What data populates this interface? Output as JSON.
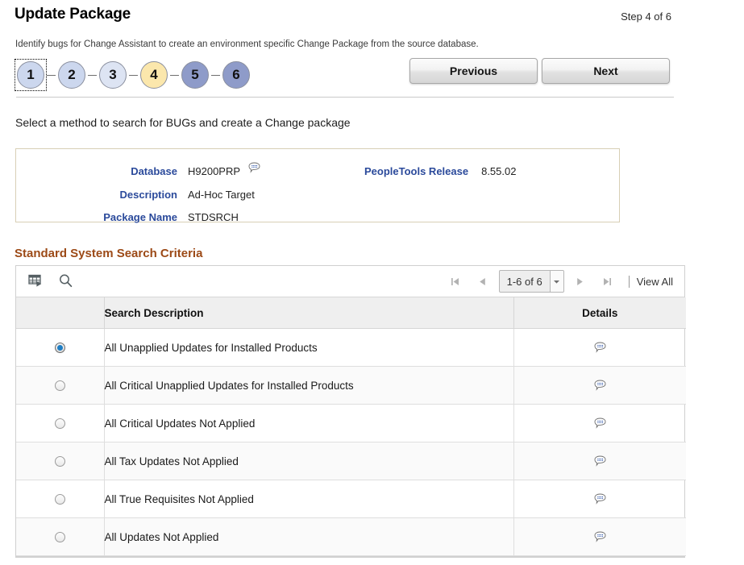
{
  "header": {
    "title": "Update Package",
    "step_of": "Step 4 of 6"
  },
  "instruction": "Identify bugs for Change Assistant to create an environment specific Change Package from the source database.",
  "sub_instruction": "Select a method to search for BUGs and create a Change package",
  "steps": [
    {
      "number": "1",
      "state": "done",
      "color": "#ccd7ee",
      "focused": true
    },
    {
      "number": "2",
      "state": "done",
      "color": "#ccd7ee",
      "focused": false
    },
    {
      "number": "3",
      "state": "done",
      "color": "#dde4f3",
      "focused": false
    },
    {
      "number": "4",
      "state": "current",
      "color": "#fbe7ac",
      "focused": false
    },
    {
      "number": "5",
      "state": "pending",
      "color": "#8e9bc9",
      "focused": false
    },
    {
      "number": "6",
      "state": "pending",
      "color": "#8e9bc9",
      "focused": false
    }
  ],
  "nav": {
    "previous_label": "Previous",
    "next_label": "Next"
  },
  "info_panel": {
    "database_label": "Database",
    "database_value": "H9200PRP",
    "database_comment_icon": "comment-bubble-icon",
    "description_label": "Description",
    "description_value": "Ad-Hoc Target",
    "package_name_label": "Package Name",
    "package_name_value": "STDSRCH",
    "peopletools_label": "PeopleTools Release",
    "peopletools_value": "8.55.02"
  },
  "grid": {
    "section_title": "Standard System Search Criteria",
    "toolbar": {
      "personalize_icon": "grid-personalize-icon",
      "search_icon": "search-icon"
    },
    "pager": {
      "first_icon": "first-page-icon",
      "prev_icon": "previous-page-icon",
      "range_label": "1-6 of 6",
      "dropdown_icon": "chevron-down-icon",
      "next_icon": "next-page-icon",
      "last_icon": "last-page-icon",
      "view_all_label": "View All"
    },
    "columns": [
      "",
      "Search Description",
      "Details"
    ],
    "rows": [
      {
        "selected": true,
        "description": "All Unapplied Updates for Installed Products",
        "details_icon": "comment-bubble-icon"
      },
      {
        "selected": false,
        "description": "All Critical Unapplied Updates for Installed Products",
        "details_icon": "comment-bubble-icon"
      },
      {
        "selected": false,
        "description": "All Critical Updates Not Applied",
        "details_icon": "comment-bubble-icon"
      },
      {
        "selected": false,
        "description": "All Tax Updates Not Applied",
        "details_icon": "comment-bubble-icon"
      },
      {
        "selected": false,
        "description": "All True Requisites Not Applied",
        "details_icon": "comment-bubble-icon"
      },
      {
        "selected": false,
        "description": "All Updates Not Applied",
        "details_icon": "comment-bubble-icon"
      }
    ]
  },
  "colors": {
    "label_blue": "#2b4a9b",
    "section_brown": "#9c4a17",
    "radio_dot_blue": "#1f7ec4",
    "panel_border": "#d8cfb5"
  }
}
